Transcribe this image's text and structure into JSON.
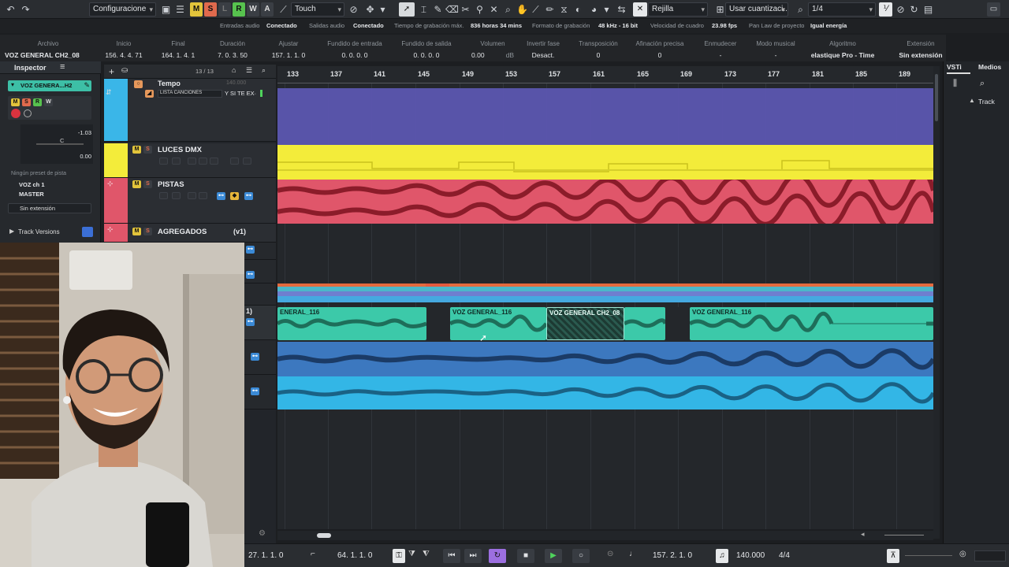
{
  "toolbar": {
    "config_label": "Configuracione",
    "automation_mode": "Touch",
    "grid_type": "Rejilla",
    "quantize_mode": "Usar cuantizaci...",
    "quantize_value": "1/4",
    "mode_buttons": [
      "M",
      "S",
      "L",
      "R",
      "W",
      "A"
    ]
  },
  "statusline": {
    "items": [
      {
        "label": "Entradas audio",
        "value": ""
      },
      {
        "label": "",
        "value": "Conectado"
      },
      {
        "label": "Salidas audio",
        "value": ""
      },
      {
        "label": "",
        "value": "Conectado"
      },
      {
        "label": "Tiempo de grabación máx.",
        "value": ""
      },
      {
        "label": "",
        "value": "836 horas 34 mins"
      },
      {
        "label": "Formato de grabación",
        "value": ""
      },
      {
        "label": "",
        "value": "48 kHz - 16 bit"
      },
      {
        "label": "Velocidad de cuadro",
        "value": ""
      },
      {
        "label": "",
        "value": "23.98 fps"
      },
      {
        "label": "Pan Law de proyecto",
        "value": ""
      },
      {
        "label": "",
        "value": "Igual energía"
      }
    ]
  },
  "infoline": {
    "columns": [
      {
        "h": "Archivo",
        "v": "VOZ GENERAL CH2_08"
      },
      {
        "h": "Inicio",
        "v": "156. 4. 4. 71"
      },
      {
        "h": "Final",
        "v": "164. 1. 4. 1"
      },
      {
        "h": "Duración",
        "v": "7. 0. 3. 50"
      },
      {
        "h": "Ajustar",
        "v": "157. 1. 1. 0"
      },
      {
        "h": "Fundido de entrada",
        "v": "0. 0. 0. 0"
      },
      {
        "h": "Fundido de salida",
        "v": "0. 0. 0. 0"
      },
      {
        "h": "Volumen",
        "v": "0.00"
      },
      {
        "h": "Invertir fase",
        "v": "Desact."
      },
      {
        "h": "Transposición",
        "v": "0"
      },
      {
        "h": "Afinación precisa",
        "v": "0"
      },
      {
        "h": "Enmudecer",
        "v": "-"
      },
      {
        "h": "Modo musical",
        "v": "-"
      },
      {
        "h": "Algoritmo",
        "v": "elastique Pro - Time"
      },
      {
        "h": "Extensión",
        "v": "Sin extensión"
      }
    ],
    "volume_unit": "dB"
  },
  "inspector": {
    "title": "Inspector",
    "track_name": "VOZ GENERA...H2",
    "volume_value": "-1.03",
    "pan_value": "C",
    "eq_value": "0.00",
    "preset": "Ningún preset de pista",
    "input": "VOZ ch 1",
    "output": "MASTER",
    "extension": "Sin extensión",
    "track_versions": "Track Versions"
  },
  "tracklist": {
    "count": "13 / 13",
    "tempo_label": "Tempo",
    "tempo_value": "140.000",
    "song_list_label": "LISTA CANCIONES",
    "song_value": "Y SI TE EX·",
    "tracks": [
      {
        "name": "LUCES DMX",
        "color": "#f3ec3a"
      },
      {
        "name": "PISTAS",
        "color": "#e0566a"
      },
      {
        "name": "AGREGADOS",
        "color": "#f3ec3a",
        "version": "(v1)"
      }
    ],
    "partial_label": "1)"
  },
  "ruler": {
    "ticks": [
      "133",
      "137",
      "141",
      "145",
      "149",
      "153",
      "157",
      "161",
      "165",
      "169",
      "173",
      "177",
      "181",
      "185",
      "189"
    ]
  },
  "events": {
    "voz_1": "ENERAL_116",
    "voz_2": "VOZ GENERAL_116",
    "voz_3": "VOZ GENERAL CH2_08",
    "voz_4": "VOZ GENERAL_116"
  },
  "rightpanel": {
    "tab_vsti": "VSTi",
    "tab_medios": "Medios",
    "track_label": "Track"
  },
  "transport": {
    "left_locator": "27. 1. 1. 0",
    "right_locator": "64. 1. 1. 0",
    "position": "157. 2. 1. 0",
    "tempo": "140.000",
    "signature": "4/4"
  },
  "colors": {
    "tempo_lane": "#5c56b0",
    "dmx_lane": "#f3ec3a",
    "pistas_lane": "#e0566a",
    "voz_event": "#3cc9a9",
    "blue_lane": "#3c78bf",
    "cyan_lane": "#33b6e6"
  }
}
